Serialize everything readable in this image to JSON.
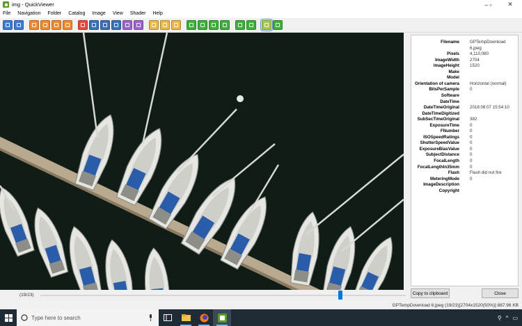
{
  "window": {
    "title": "img - QuickViewer",
    "icon": "quickviewer-app-icon",
    "controls": [
      "minimize-icon",
      "maximize-icon",
      "close-icon"
    ]
  },
  "menu": [
    "File",
    "Navigation",
    "Folder",
    "Catalog",
    "Image",
    "View",
    "Shader",
    "Help"
  ],
  "toolbar": [
    {
      "name": "prev-page-button",
      "icon": "arrow-left-icon",
      "color": "#3b7bd4"
    },
    {
      "name": "next-page-button",
      "icon": "arrow-right-icon",
      "color": "#3b7bd4"
    },
    {
      "name": "rewind-button",
      "icon": "double-arrow-left-icon",
      "color": "#f08a30"
    },
    {
      "name": "fast-forward-button",
      "icon": "double-arrow-right-icon",
      "color": "#f08a30"
    },
    {
      "name": "first-page-button",
      "icon": "skip-first-icon",
      "color": "#f08a30"
    },
    {
      "name": "last-page-button",
      "icon": "skip-last-icon",
      "color": "#f08a30"
    },
    {
      "name": "delete-button",
      "icon": "trash-icon",
      "color": "#e24c3c"
    },
    {
      "name": "spread-view-button",
      "icon": "book-icon",
      "color": "#3b6fb8"
    },
    {
      "name": "single-view-button",
      "icon": "page-icon",
      "color": "#3b6fb8"
    },
    {
      "name": "spread-right-button",
      "icon": "book-right-icon",
      "color": "#3b6fb8"
    },
    {
      "name": "spread-left-button",
      "icon": "book-left-icon",
      "color": "#9a64c8"
    },
    {
      "name": "page-view-button",
      "icon": "page-view-icon",
      "color": "#9a64c8"
    },
    {
      "name": "open-folder-button",
      "icon": "folder-icon",
      "color": "#e8b84a"
    },
    {
      "name": "catalog-button",
      "icon": "catalog-icon",
      "color": "#e8b84a"
    },
    {
      "name": "preferences-button",
      "icon": "gear-icon",
      "color": "#e8b84a"
    },
    {
      "name": "rotate-button",
      "icon": "rotate-icon",
      "color": "#3fae3a"
    },
    {
      "name": "zoom-in-button",
      "icon": "plus-icon",
      "color": "#3fae3a"
    },
    {
      "name": "zoom-out-button",
      "icon": "minus-icon",
      "color": "#3fae3a"
    },
    {
      "name": "fit-zoom-button",
      "icon": "magnifier-icon",
      "color": "#3fae3a"
    },
    {
      "name": "fullscreen-button",
      "icon": "fullscreen-icon",
      "color": "#3fae3a"
    },
    {
      "name": "slideshow-button",
      "icon": "slideshow-icon",
      "color": "#3fae3a"
    },
    {
      "name": "exif-panel-button",
      "icon": "info-panel-icon",
      "color": "#a5c84a",
      "active": true
    },
    {
      "name": "stay-on-top-button",
      "icon": "pin-icon",
      "color": "#3fae3a"
    }
  ],
  "exif": [
    {
      "key": "Filename",
      "value": "GPTempDownload"
    },
    {
      "key": "",
      "value": "6.jpeg"
    },
    {
      "key": "Pixels",
      "value": "4,110,080"
    },
    {
      "key": "ImageWidth",
      "value": "2704"
    },
    {
      "key": "ImageHeight",
      "value": "1520"
    },
    {
      "key": "Make",
      "value": ""
    },
    {
      "key": "Model",
      "value": ""
    },
    {
      "key": "Orientation of camera",
      "value": "Horizontal (normal)"
    },
    {
      "key": "BitsPerSample",
      "value": "0"
    },
    {
      "key": "Software",
      "value": ""
    },
    {
      "key": "DateTime",
      "value": ""
    },
    {
      "key": "DateTimeOriginal",
      "value": "2018:08:07 15:54:10"
    },
    {
      "key": "DateTimeDigitized",
      "value": ""
    },
    {
      "key": "SubSecTimeOriginal",
      "value": "382"
    },
    {
      "key": "ExposureTime",
      "value": "0"
    },
    {
      "key": "FNumber",
      "value": "0"
    },
    {
      "key": "ISOSpeedRatings",
      "value": "0"
    },
    {
      "key": "ShutterSpeedValue",
      "value": "0"
    },
    {
      "key": "ExposureBiasValue",
      "value": "0"
    },
    {
      "key": "SubjectDistance",
      "value": "0"
    },
    {
      "key": "FocalLength",
      "value": "0"
    },
    {
      "key": "FocalLengthIn35mm",
      "value": "0"
    },
    {
      "key": "Flash",
      "value": "Flash did not fire"
    },
    {
      "key": "MeteringMode",
      "value": "0"
    },
    {
      "key": "ImageDescription",
      "value": ""
    },
    {
      "key": "Copyright",
      "value": ""
    }
  ],
  "buttons": {
    "copy": "Copy to clipboard",
    "close": "Close"
  },
  "page_counter": "(19/23)",
  "page_progress": 0.82,
  "status": "GPTempDownload 6.jpeg (19/23)[2704x1520(50%)] 887.96 KB",
  "taskbar": {
    "search_placeholder": "Type here to search",
    "apps": [
      "task-view-icon",
      "file-explorer-icon",
      "firefox-icon",
      "quickviewer-icon"
    ]
  },
  "colors": {
    "water": "#0c1712",
    "dock": "#b9a98f",
    "hull": "#e6e6e2",
    "cover": "#2a5caa",
    "accent": "#0078d7",
    "taskbar": "#1f2b35"
  }
}
